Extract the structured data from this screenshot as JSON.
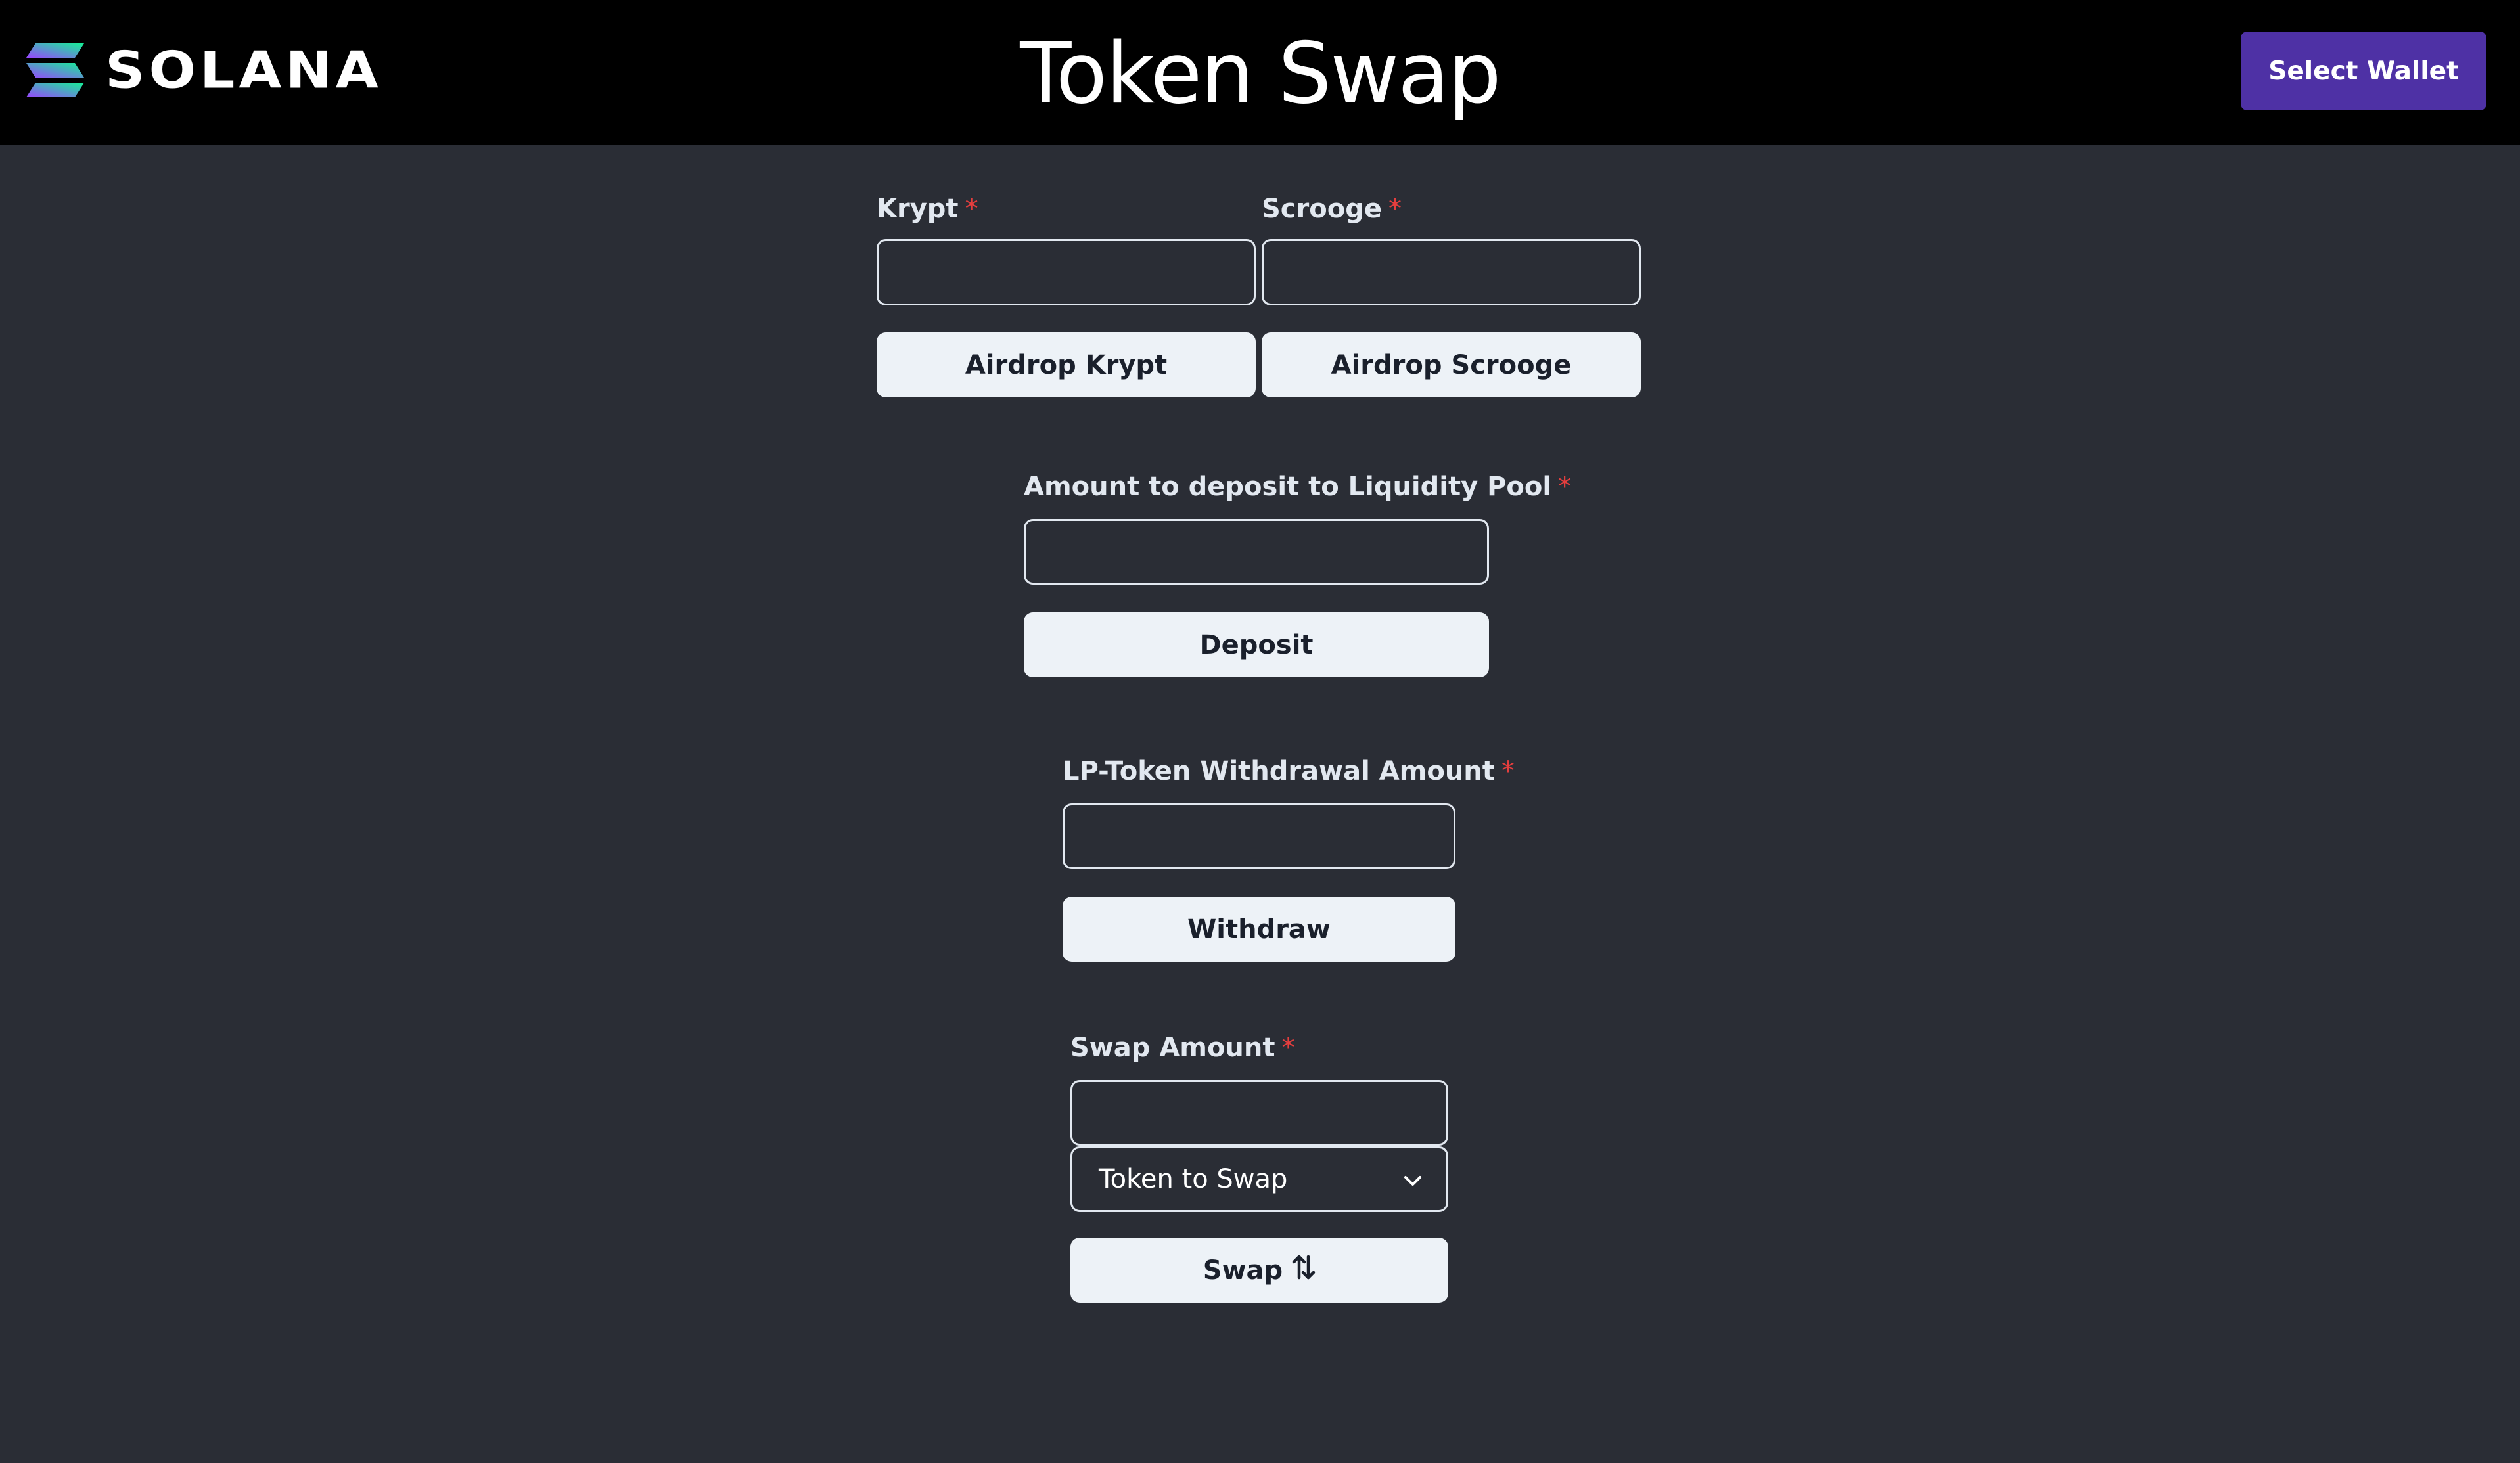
{
  "header": {
    "logo_text": "SOLANA",
    "title": "Token Swap",
    "wallet_button": "Select Wallet",
    "colors": {
      "background": "#000000",
      "wallet_button": "#4e31a5",
      "logo_gradient": [
        "#9945ff",
        "#14f195"
      ]
    }
  },
  "airdrop": {
    "krypt_label": "Krypt",
    "scrooge_label": "Scrooge",
    "required_marker": "*",
    "krypt_value": "",
    "scrooge_value": "",
    "krypt_button": "Airdrop Krypt",
    "scrooge_button": "Airdrop Scrooge"
  },
  "deposit": {
    "label": "Amount to deposit to Liquidity Pool",
    "required_marker": "*",
    "value": "",
    "button": "Deposit"
  },
  "withdraw": {
    "label": "LP-Token Withdrawal Amount",
    "required_marker": "*",
    "value": "",
    "button": "Withdraw"
  },
  "swap": {
    "label": "Swap Amount",
    "required_marker": "*",
    "value": "",
    "token_select": "Token to Swap",
    "button": "Swap",
    "button_icon": "swap-vertical-arrows-icon"
  },
  "colors": {
    "page_background": "#2a2d35",
    "button_background": "#edf2f7",
    "button_text": "#1a202c",
    "label_text": "#e2e8f0",
    "required": "#e53e3e"
  }
}
